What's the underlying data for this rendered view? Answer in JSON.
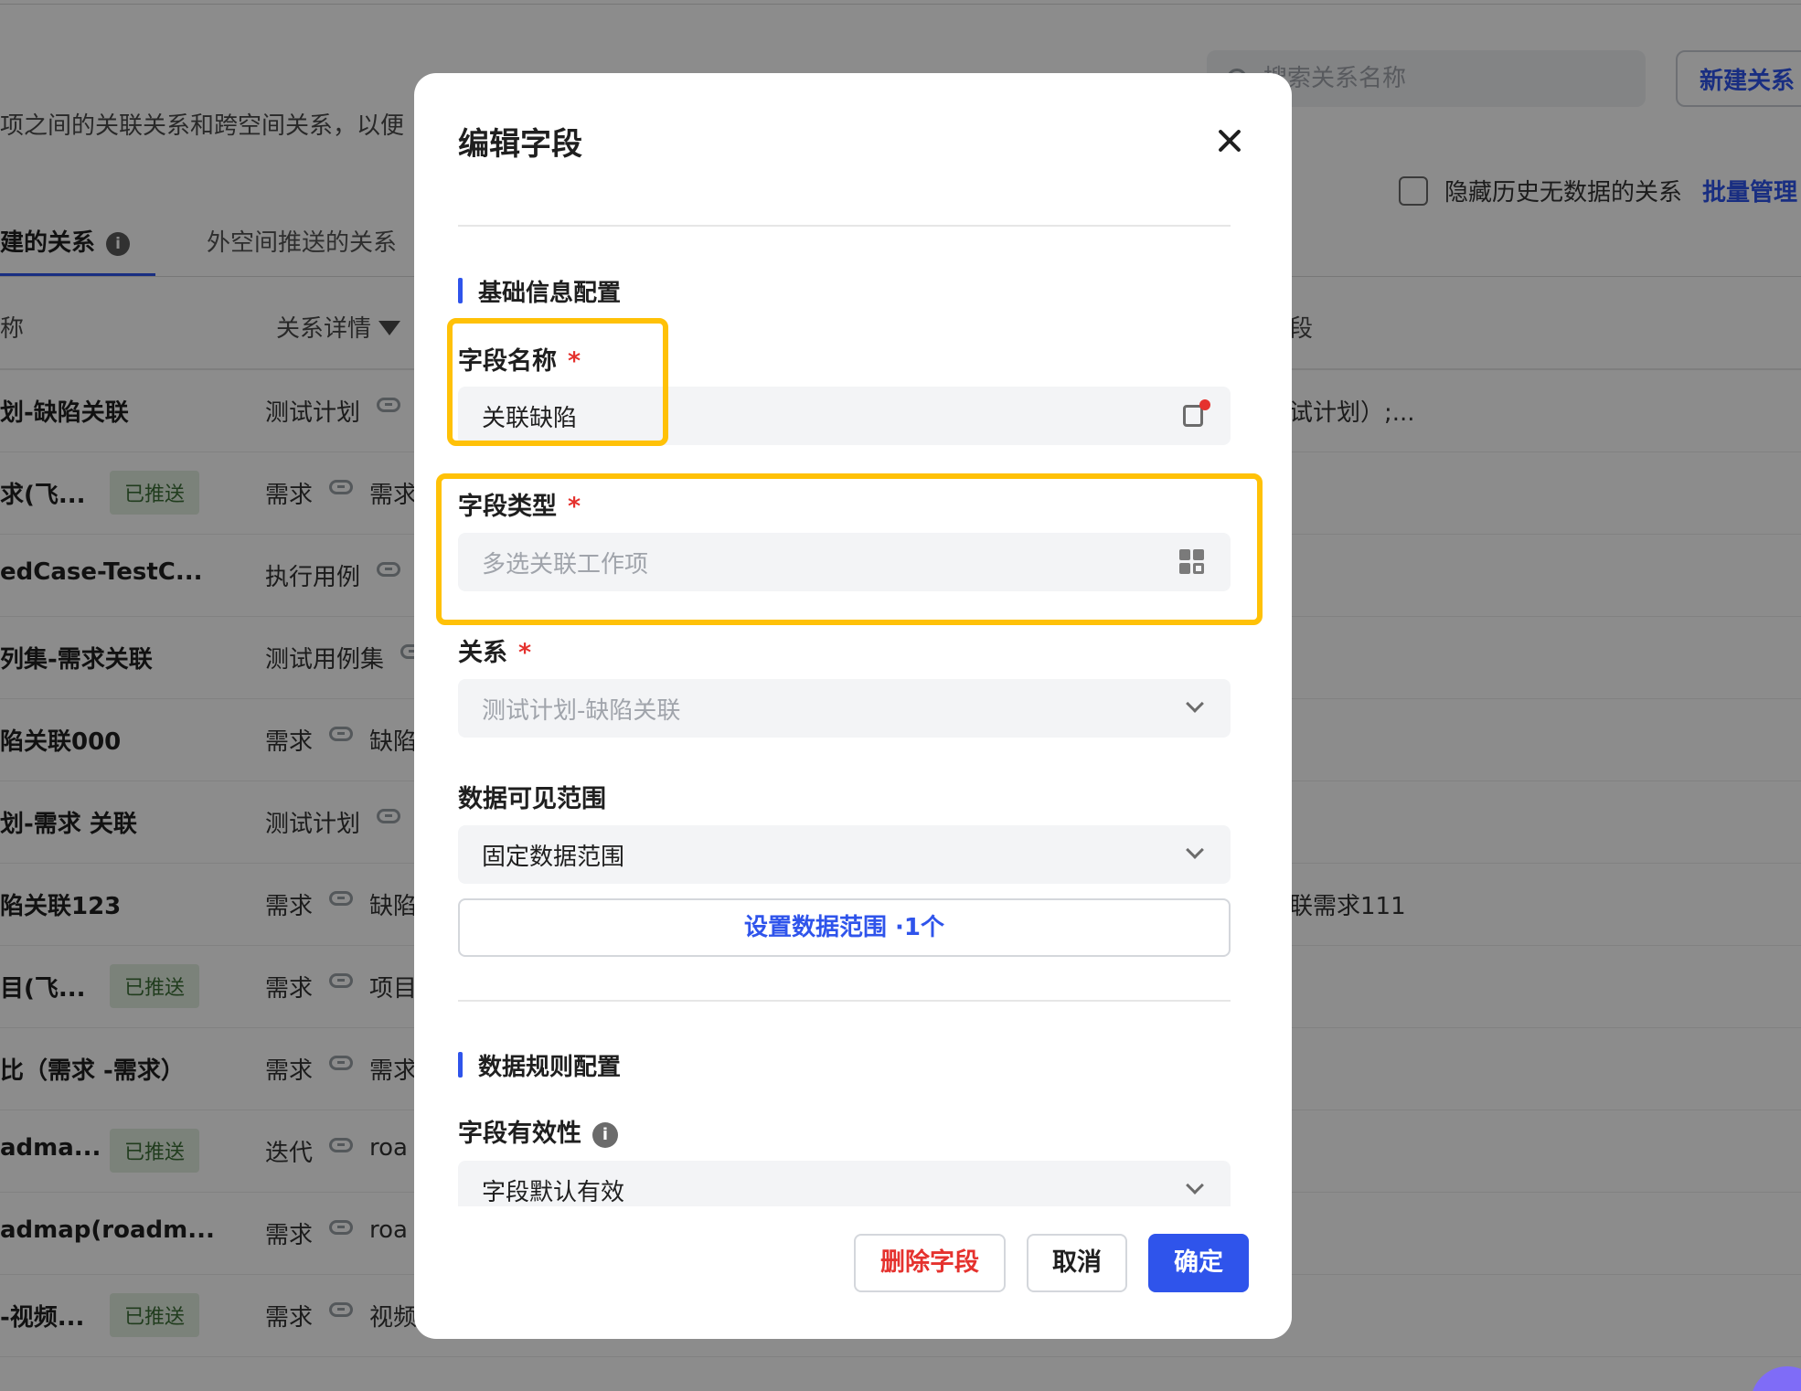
{
  "background": {
    "description_text": "项之间的关联关系和跨空间关系，以便",
    "search": {
      "placeholder": "搜索关系名称"
    },
    "new_relation_label": "新建关系",
    "hide_history_label": "隐藏历史无数据的关系",
    "batch_manage_label": "批量管理",
    "tabs": [
      {
        "label": "建的关系",
        "active": true
      },
      {
        "label": "外空间推送的关系",
        "active": false
      }
    ],
    "table_headers": {
      "name": "称",
      "detail": "关系详情",
      "field": "段"
    },
    "rows": [
      {
        "name": "划-缺陷关联",
        "badge": "",
        "from": "测试计划",
        "to": "",
        "field": "试计划）;..."
      },
      {
        "name": "求(飞...",
        "badge": "已推送",
        "from": "需求",
        "to": "需求",
        "field": ""
      },
      {
        "name": "edCase-TestC...",
        "badge": "",
        "from": "执行用例",
        "to": "",
        "field": ""
      },
      {
        "name": "列集-需求关联",
        "badge": "",
        "from": "测试用例集",
        "to": "",
        "field": ""
      },
      {
        "name": "陷关联000",
        "badge": "",
        "from": "需求",
        "to": "缺陷",
        "field": ""
      },
      {
        "name": "划-需求 关联",
        "badge": "",
        "from": "测试计划",
        "to": "",
        "field": ""
      },
      {
        "name": "陷关联123",
        "badge": "",
        "from": "需求",
        "to": "缺陷",
        "field": "联需求111"
      },
      {
        "name": "目(飞...",
        "badge": "已推送",
        "from": "需求",
        "to": "项目",
        "field": ""
      },
      {
        "name": "比（需求 -需求）",
        "badge": "",
        "from": "需求",
        "to": "需求",
        "field": ""
      },
      {
        "name": "adma...",
        "badge": "已推送",
        "from": "迭代",
        "to": "roa",
        "field": ""
      },
      {
        "name": "admap(roadm...",
        "badge": "",
        "from": "需求",
        "to": "roa",
        "field": ""
      },
      {
        "name": "-视频...",
        "badge": "已推送",
        "from": "需求",
        "to": "视频",
        "field": ""
      }
    ]
  },
  "modal": {
    "title": "编辑字段",
    "section_basic": "基础信息配置",
    "field_name": {
      "label": "字段名称",
      "required_mark": "*",
      "value": "关联缺陷"
    },
    "field_type": {
      "label": "字段类型",
      "required_mark": "*",
      "placeholder": "多选关联工作项"
    },
    "relation": {
      "label": "关系",
      "required_mark": "*",
      "value": "测试计划-缺陷关联"
    },
    "data_scope": {
      "label": "数据可见范围",
      "value": "固定数据范围",
      "set_button": "设置数据范围 ·1个"
    },
    "section_rules": "数据规则配置",
    "validity": {
      "label": "字段有效性",
      "value": "字段默认有效"
    },
    "buttons": {
      "delete": "删除字段",
      "cancel": "取消",
      "confirm": "确定"
    }
  },
  "colors": {
    "accent": "#2f54eb",
    "highlight": "#ffc107",
    "danger": "#e5322e",
    "badge_bg": "#e1eddf"
  }
}
